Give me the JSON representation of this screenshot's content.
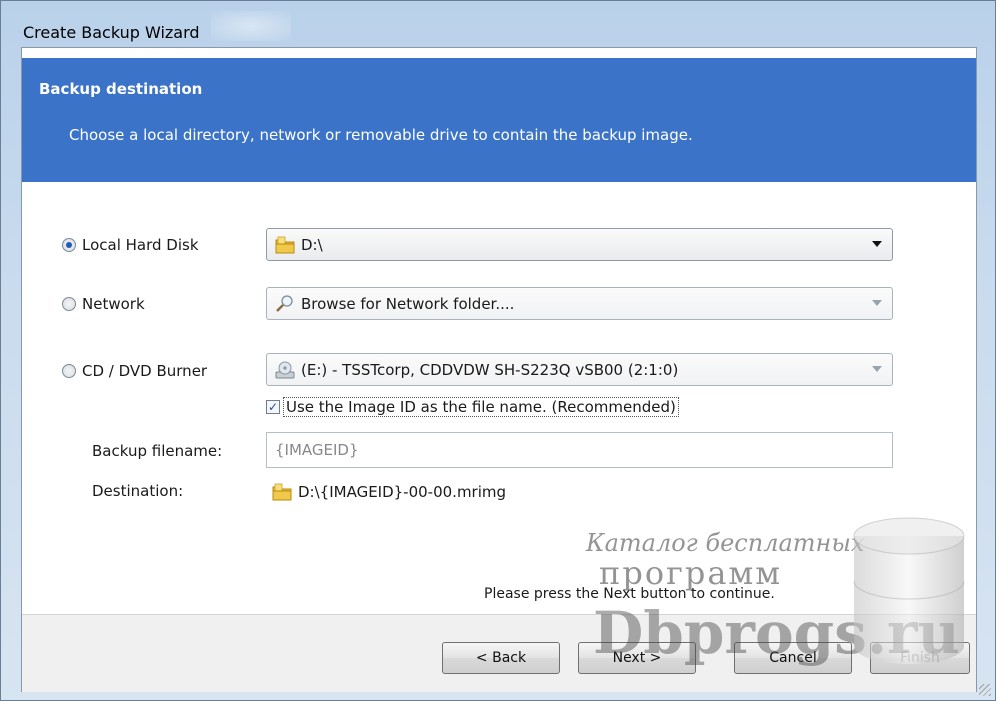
{
  "window": {
    "title": "Create Backup Wizard"
  },
  "header": {
    "title": "Backup destination",
    "subtitle": "Choose a local directory, network  or removable drive to contain the backup image."
  },
  "options": {
    "local": {
      "label": "Local Hard Disk",
      "selected": true,
      "value": "D:\\",
      "icon": "folder-icon"
    },
    "network": {
      "label": "Network",
      "selected": false,
      "value": "Browse for Network folder....",
      "icon": "magnifier-icon"
    },
    "cd": {
      "label": "CD / DVD Burner",
      "selected": false,
      "value": "(E:) - TSSTcorp, CDDVDW SH-S223Q  vSB00 (2:1:0)",
      "icon": "cd-drive-icon"
    }
  },
  "use_image_id": {
    "checked": true,
    "label": "Use the Image ID as the file name.  (Recommended)"
  },
  "filename": {
    "label": "Backup filename:",
    "value": "{IMAGEID}"
  },
  "destination": {
    "label": "Destination:",
    "value": "D:\\{IMAGEID}-00-00.mrimg"
  },
  "footer": {
    "hint": "Please press the  Next  button to continue.",
    "back": "< Back",
    "next": "Next >",
    "cancel": "Cancel",
    "finish": "Finish"
  },
  "watermark": {
    "line1": "Каталог бесплатных",
    "line2": "программ",
    "line3": "Dbprogs.ru"
  },
  "colors": {
    "header_bg": "#3a73c8",
    "window_frame": "#c9dbee"
  }
}
